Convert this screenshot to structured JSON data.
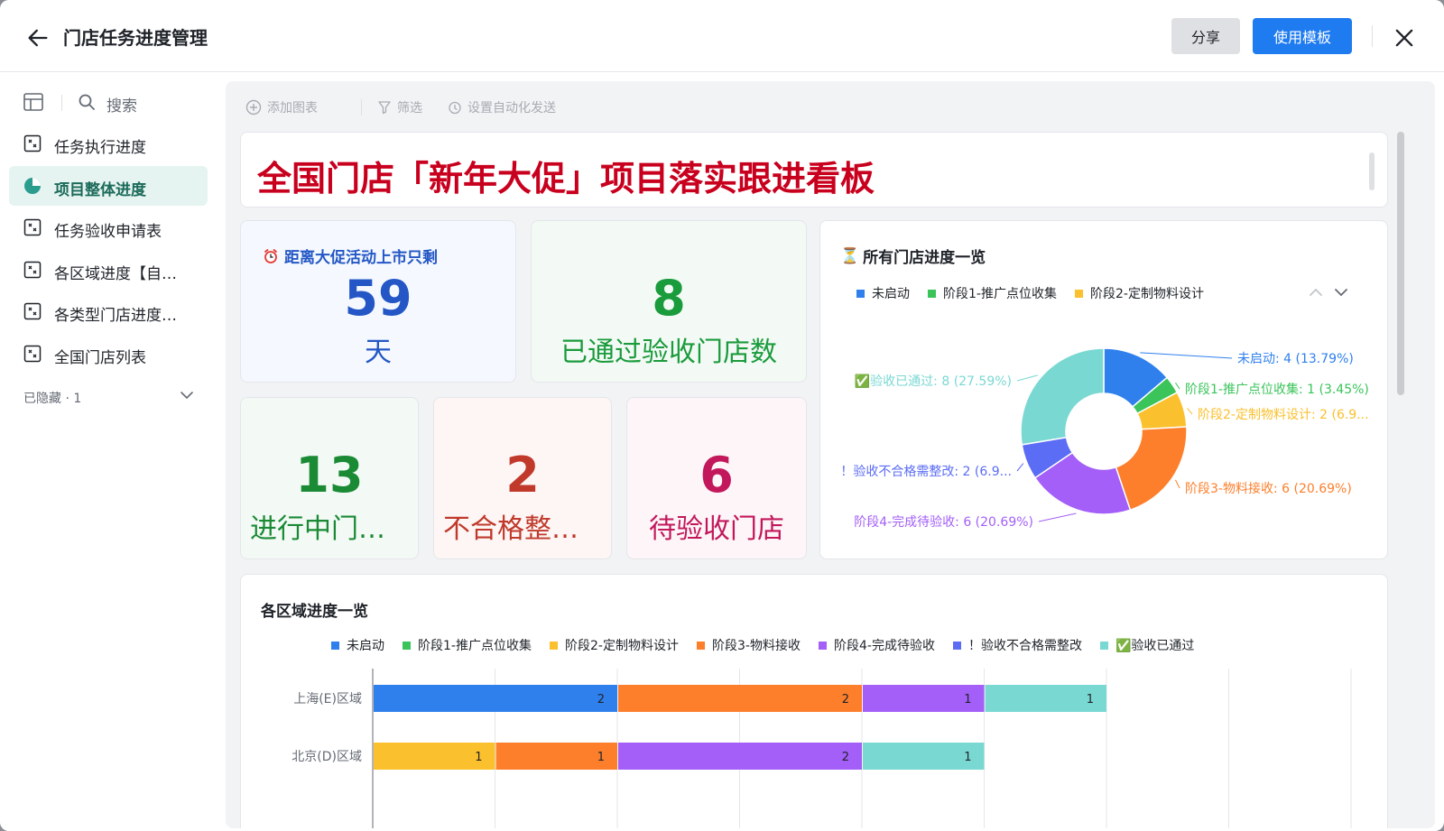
{
  "window": {
    "title": "门店任务进度管理"
  },
  "header": {
    "share_label": "分享",
    "use_template_label": "使用模板"
  },
  "sidebar": {
    "search_label": "搜索",
    "items": [
      {
        "label": "任务执行进度",
        "icon": "table-icon",
        "active": false
      },
      {
        "label": "项目整体进度",
        "icon": "pie-chart-icon",
        "active": true
      },
      {
        "label": "任务验收申请表",
        "icon": "table-icon",
        "active": false
      },
      {
        "label": "各区域进度【自…",
        "icon": "table-icon",
        "active": false
      },
      {
        "label": "各类型门店进度…",
        "icon": "table-icon",
        "active": false
      },
      {
        "label": "全国门店列表",
        "icon": "table-icon",
        "active": false
      }
    ],
    "hidden_label": "已隐藏 · 1"
  },
  "toolbar": {
    "add_chart": "添加图表",
    "filter": "筛选",
    "auto_send": "设置自动化发送"
  },
  "banner": {
    "title": "全国门店「新年大促」项目落实跟进看板"
  },
  "kpis": {
    "countdown": {
      "label": "距离大促活动上市只剩",
      "value": "59",
      "unit": "天",
      "color": "#2457c5"
    },
    "passed": {
      "value": "8",
      "label": "已通过验收门店数",
      "color": "#1a9b3c"
    },
    "in_progress": {
      "value": "13",
      "label": "进行中门…",
      "color": "#1a8a35"
    },
    "failed": {
      "value": "2",
      "label": "不合格整…",
      "color": "#c0392b"
    },
    "pending": {
      "value": "6",
      "label": "待验收门店",
      "color": "#c2185b"
    }
  },
  "colors": {
    "not_started": "#2f80ed",
    "stage1": "#3ac45a",
    "stage2": "#fbc02d",
    "stage3": "#fd7f2c",
    "stage4": "#a35ff7",
    "failed": "#5b6cf5",
    "passed": "#7ad8d3"
  },
  "chart_data": [
    {
      "type": "pie",
      "title": "所有门店进度一览",
      "donut": true,
      "legend_position": "top",
      "legend_visible": [
        "未启动",
        "阶段1-推广点位收集",
        "阶段2-定制物料设计"
      ],
      "slices": [
        {
          "name": "未启动",
          "value": 4,
          "label": "未启动: 4 (13.79%)",
          "color": "#2f80ed"
        },
        {
          "name": "阶段1-推广点位收集",
          "value": 1,
          "label": "阶段1-推广点位收集: 1 (3.45%)",
          "color": "#3ac45a"
        },
        {
          "name": "阶段2-定制物料设计",
          "value": 2,
          "label": "阶段2-定制物料设计: 2 (6.9...",
          "color": "#fbc02d"
        },
        {
          "name": "阶段3-物料接收",
          "value": 6,
          "label": "阶段3-物料接收: 6 (20.69%)",
          "color": "#fd7f2c"
        },
        {
          "name": "阶段4-完成待验收",
          "value": 6,
          "label": "阶段4-完成待验收: 6 (20.69%)",
          "color": "#a35ff7"
        },
        {
          "name": "！验收不合格需整改",
          "value": 2,
          "label": "！验收不合格需整改: 2 (6.9...",
          "color": "#5b6cf5"
        },
        {
          "name": "✅验收已通过",
          "value": 8,
          "label": "✅验收已通过: 8 (27.59%)",
          "color": "#7ad8d3"
        }
      ]
    },
    {
      "type": "bar",
      "orientation": "horizontal",
      "stacked": true,
      "title": "各区域进度一览",
      "legend_position": "top",
      "grid": true,
      "categories": [
        "上海(E)区域",
        "北京(D)区域"
      ],
      "series": [
        {
          "name": "未启动",
          "color": "#2f80ed",
          "values": [
            2,
            0
          ]
        },
        {
          "name": "阶段1-推广点位收集",
          "color": "#3ac45a",
          "values": [
            0,
            0
          ]
        },
        {
          "name": "阶段2-定制物料设计",
          "color": "#fbc02d",
          "values": [
            0,
            1
          ]
        },
        {
          "name": "阶段3-物料接收",
          "color": "#fd7f2c",
          "values": [
            2,
            1
          ]
        },
        {
          "name": "阶段4-完成待验收",
          "color": "#a35ff7",
          "values": [
            1,
            2
          ]
        },
        {
          "name": "！验收不合格需整改",
          "color": "#5b6cf5",
          "values": [
            0,
            0
          ]
        },
        {
          "name": "✅验收已通过",
          "color": "#7ad8d3",
          "values": [
            1,
            1
          ]
        }
      ],
      "xlim": [
        0,
        8
      ]
    }
  ]
}
